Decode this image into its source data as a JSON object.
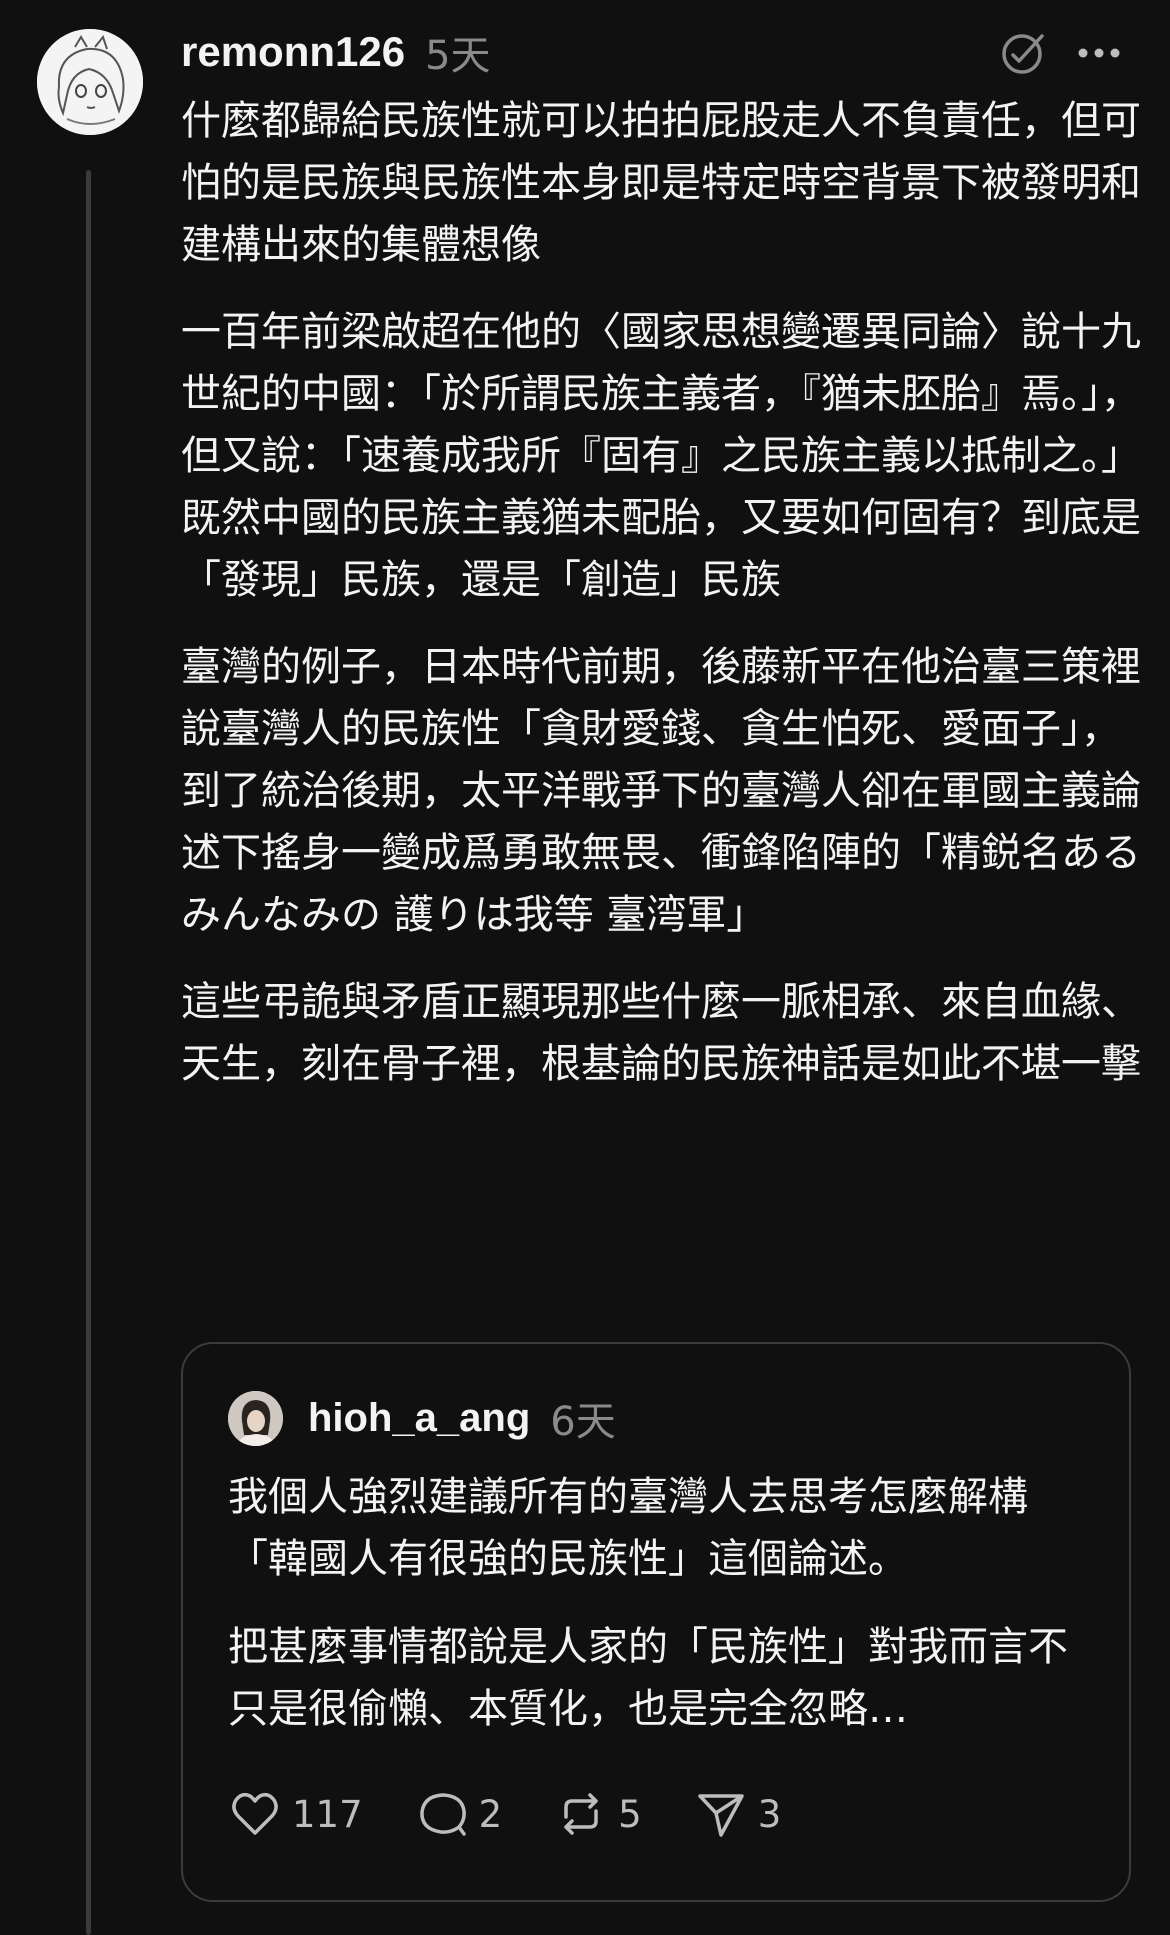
{
  "post": {
    "username": "remonn126",
    "time": "5天",
    "paragraphs": [
      "什麼都歸給民族性就可以拍拍屁股走人不負責任，但可怕的是民族與民族性本身即是特定時空背景下被發明和建構出來的集體想像",
      "一百年前梁啟超在他的〈國家思想變遷異同論〉說十九世紀的中國：「於所謂民族主義者，『猶未胚胎』焉。」，但又說：「速養成我所『固有』之民族主義以抵制之。」",
      "既然中國的民族主義猶未配胎，又要如何固有？到底是「發現」民族，還是「創造」民族",
      "臺灣的例子，日本時代前期，後藤新平在他治臺三策裡說臺灣人的民族性「貪財愛錢、貪生怕死、愛面子」，到了統治後期，太平洋戰爭下的臺灣人卻在軍國主義論述下搖身一變成爲勇敢無畏、衝鋒陷陣的「精鋭名あるみんなみの 護りは我等 臺湾軍」",
      "這些弔詭與矛盾正顯現那些什麼一脈相承、來自血緣、天生，刻在骨子裡，根基論的民族神話是如此不堪一擊"
    ]
  },
  "quote": {
    "username": "hioh_a_ang",
    "time": "6天",
    "paragraphs": [
      "我個人強烈建議所有的臺灣人去思考怎麼解構「韓國人有很強的民族性」這個論述。",
      "把甚麼事情都說是人家的「民族性」對我而言不只是很偷懶、本質化，也是完全忽略…"
    ],
    "actions": {
      "likes": "117",
      "replies": "2",
      "reposts": "5",
      "shares": "3"
    }
  },
  "icons": [
    "edit-check-icon",
    "more-icon",
    "heart-icon",
    "comment-icon",
    "repost-icon",
    "share-icon"
  ]
}
